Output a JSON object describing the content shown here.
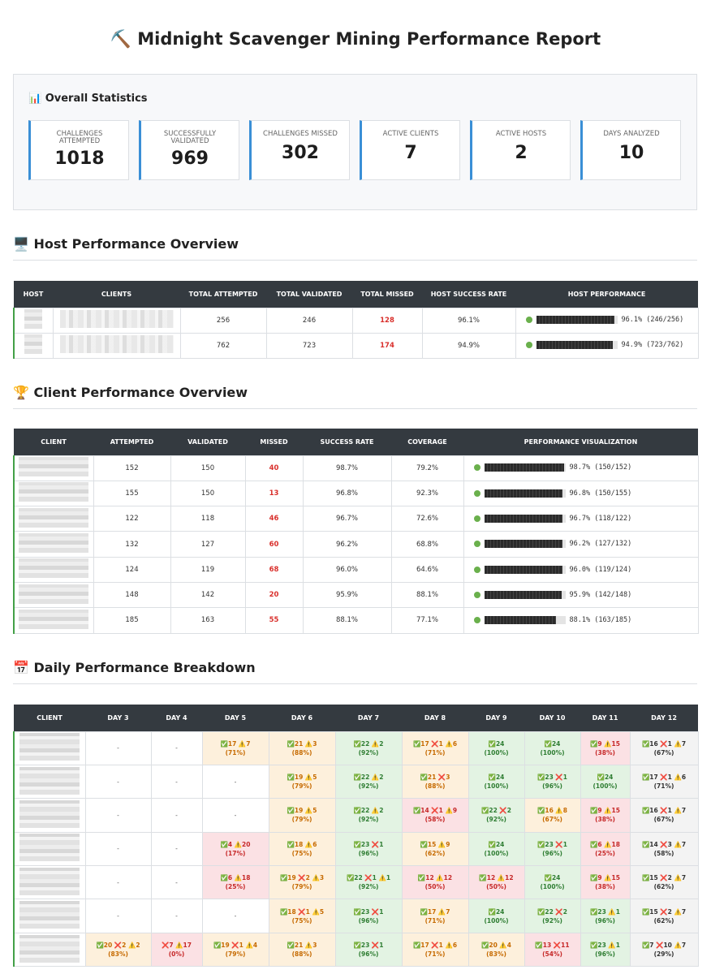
{
  "title": "⛏️ Midnight Scavenger Mining Performance Report",
  "stats": {
    "heading": "📊 Overall Statistics",
    "cards": [
      {
        "label": "Challenges Attempted",
        "value": "1018"
      },
      {
        "label": "Successfully Validated",
        "value": "969"
      },
      {
        "label": "Challenges Missed",
        "value": "302"
      },
      {
        "label": "Active Clients",
        "value": "7"
      },
      {
        "label": "Active Hosts",
        "value": "2"
      },
      {
        "label": "Days Analyzed",
        "value": "10"
      }
    ]
  },
  "host_section": {
    "title": "🖥️ Host Performance Overview",
    "columns": [
      "Host",
      "Clients",
      "Total Attempted",
      "Total Validated",
      "Total Missed",
      "Host Success Rate",
      "Host Performance"
    ],
    "rows": [
      {
        "attempted": "256",
        "validated": "246",
        "missed": "128",
        "rate": "96.1%",
        "viz": "96.1% (246/256)",
        "fill": 0.961
      },
      {
        "attempted": "762",
        "validated": "723",
        "missed": "174",
        "rate": "94.9%",
        "viz": "94.9% (723/762)",
        "fill": 0.949
      }
    ]
  },
  "client_section": {
    "title": "🏆 Client Performance Overview",
    "columns": [
      "Client",
      "Attempted",
      "Validated",
      "Missed",
      "Success Rate",
      "Coverage",
      "Performance Visualization"
    ],
    "rows": [
      {
        "attempted": "152",
        "validated": "150",
        "missed": "40",
        "rate": "98.7%",
        "coverage": "79.2%",
        "viz": "98.7% (150/152)",
        "fill": 0.987
      },
      {
        "attempted": "155",
        "validated": "150",
        "missed": "13",
        "rate": "96.8%",
        "coverage": "92.3%",
        "viz": "96.8% (150/155)",
        "fill": 0.968
      },
      {
        "attempted": "122",
        "validated": "118",
        "missed": "46",
        "rate": "96.7%",
        "coverage": "72.6%",
        "viz": "96.7% (118/122)",
        "fill": 0.967
      },
      {
        "attempted": "132",
        "validated": "127",
        "missed": "60",
        "rate": "96.2%",
        "coverage": "68.8%",
        "viz": "96.2% (127/132)",
        "fill": 0.962
      },
      {
        "attempted": "124",
        "validated": "119",
        "missed": "68",
        "rate": "96.0%",
        "coverage": "64.6%",
        "viz": "96.0% (119/124)",
        "fill": 0.96
      },
      {
        "attempted": "148",
        "validated": "142",
        "missed": "20",
        "rate": "95.9%",
        "coverage": "88.1%",
        "viz": "95.9% (142/148)",
        "fill": 0.959
      },
      {
        "attempted": "185",
        "validated": "163",
        "missed": "55",
        "rate": "88.1%",
        "coverage": "77.1%",
        "viz": "88.1% (163/185)",
        "fill": 0.881
      }
    ]
  },
  "daily_section": {
    "title": "📅 Daily Performance Breakdown",
    "columns": [
      "Client",
      "Day 3",
      "Day 4",
      "Day 5",
      "Day 6",
      "Day 7",
      "Day 8",
      "Day 9",
      "Day 10",
      "Day 11",
      "Day 12"
    ],
    "rows": [
      [
        {
          "t": "-",
          "p": "",
          "c": "empty"
        },
        {
          "t": "-",
          "p": "",
          "c": "empty"
        },
        {
          "t": "✅17 ⚠️7",
          "p": "(71%)",
          "c": "orange"
        },
        {
          "t": "✅21 ⚠️3",
          "p": "(88%)",
          "c": "orange"
        },
        {
          "t": "✅22 ⚠️2",
          "p": "(92%)",
          "c": "green"
        },
        {
          "t": "✅17 ❌1 ⚠️6",
          "p": "(71%)",
          "c": "orange"
        },
        {
          "t": "✅24",
          "p": "(100%)",
          "c": "green"
        },
        {
          "t": "✅24",
          "p": "(100%)",
          "c": "green"
        },
        {
          "t": "✅9 ⚠️15",
          "p": "(38%)",
          "c": "red"
        },
        {
          "t": "✅16 ❌1 ⚠️7",
          "p": "(67%)",
          "c": "gray"
        }
      ],
      [
        {
          "t": "-",
          "p": "",
          "c": "empty"
        },
        {
          "t": "-",
          "p": "",
          "c": "empty"
        },
        {
          "t": "-",
          "p": "",
          "c": "empty"
        },
        {
          "t": "✅19 ⚠️5",
          "p": "(79%)",
          "c": "orange"
        },
        {
          "t": "✅22 ⚠️2",
          "p": "(92%)",
          "c": "green"
        },
        {
          "t": "✅21 ❌3",
          "p": "(88%)",
          "c": "orange"
        },
        {
          "t": "✅24",
          "p": "(100%)",
          "c": "green"
        },
        {
          "t": "✅23 ❌1",
          "p": "(96%)",
          "c": "green"
        },
        {
          "t": "✅24",
          "p": "(100%)",
          "c": "green"
        },
        {
          "t": "✅17 ❌1 ⚠️6",
          "p": "(71%)",
          "c": "gray"
        }
      ],
      [
        {
          "t": "-",
          "p": "",
          "c": "empty"
        },
        {
          "t": "-",
          "p": "",
          "c": "empty"
        },
        {
          "t": "-",
          "p": "",
          "c": "empty"
        },
        {
          "t": "✅19 ⚠️5",
          "p": "(79%)",
          "c": "orange"
        },
        {
          "t": "✅22 ⚠️2",
          "p": "(92%)",
          "c": "green"
        },
        {
          "t": "✅14 ❌1 ⚠️9",
          "p": "(58%)",
          "c": "red"
        },
        {
          "t": "✅22 ❌2",
          "p": "(92%)",
          "c": "green"
        },
        {
          "t": "✅16 ⚠️8",
          "p": "(67%)",
          "c": "orange"
        },
        {
          "t": "✅9 ⚠️15",
          "p": "(38%)",
          "c": "red"
        },
        {
          "t": "✅16 ❌1 ⚠️7",
          "p": "(67%)",
          "c": "gray"
        }
      ],
      [
        {
          "t": "-",
          "p": "",
          "c": "empty"
        },
        {
          "t": "-",
          "p": "",
          "c": "empty"
        },
        {
          "t": "✅4 ⚠️20",
          "p": "(17%)",
          "c": "red"
        },
        {
          "t": "✅18 ⚠️6",
          "p": "(75%)",
          "c": "orange"
        },
        {
          "t": "✅23 ❌1",
          "p": "(96%)",
          "c": "green"
        },
        {
          "t": "✅15 ⚠️9",
          "p": "(62%)",
          "c": "orange"
        },
        {
          "t": "✅24",
          "p": "(100%)",
          "c": "green"
        },
        {
          "t": "✅23 ❌1",
          "p": "(96%)",
          "c": "green"
        },
        {
          "t": "✅6 ⚠️18",
          "p": "(25%)",
          "c": "red"
        },
        {
          "t": "✅14 ❌3 ⚠️7",
          "p": "(58%)",
          "c": "gray"
        }
      ],
      [
        {
          "t": "-",
          "p": "",
          "c": "empty"
        },
        {
          "t": "-",
          "p": "",
          "c": "empty"
        },
        {
          "t": "✅6 ⚠️18",
          "p": "(25%)",
          "c": "red"
        },
        {
          "t": "✅19 ❌2 ⚠️3",
          "p": "(79%)",
          "c": "orange"
        },
        {
          "t": "✅22 ❌1 ⚠️1",
          "p": "(92%)",
          "c": "green"
        },
        {
          "t": "✅12 ⚠️12",
          "p": "(50%)",
          "c": "red"
        },
        {
          "t": "✅12 ⚠️12",
          "p": "(50%)",
          "c": "red"
        },
        {
          "t": "✅24",
          "p": "(100%)",
          "c": "green"
        },
        {
          "t": "✅9 ⚠️15",
          "p": "(38%)",
          "c": "red"
        },
        {
          "t": "✅15 ❌2 ⚠️7",
          "p": "(62%)",
          "c": "gray"
        }
      ],
      [
        {
          "t": "-",
          "p": "",
          "c": "empty"
        },
        {
          "t": "-",
          "p": "",
          "c": "empty"
        },
        {
          "t": "-",
          "p": "",
          "c": "empty"
        },
        {
          "t": "✅18 ❌1 ⚠️5",
          "p": "(75%)",
          "c": "orange"
        },
        {
          "t": "✅23 ❌1",
          "p": "(96%)",
          "c": "green"
        },
        {
          "t": "✅17 ⚠️7",
          "p": "(71%)",
          "c": "orange"
        },
        {
          "t": "✅24",
          "p": "(100%)",
          "c": "green"
        },
        {
          "t": "✅22 ❌2",
          "p": "(92%)",
          "c": "green"
        },
        {
          "t": "✅23 ⚠️1",
          "p": "(96%)",
          "c": "green"
        },
        {
          "t": "✅15 ❌2 ⚠️7",
          "p": "(62%)",
          "c": "gray"
        }
      ],
      [
        {
          "t": "✅20 ❌2 ⚠️2",
          "p": "(83%)",
          "c": "orange"
        },
        {
          "t": "❌7 ⚠️17",
          "p": "(0%)",
          "c": "red"
        },
        {
          "t": "✅19 ❌1 ⚠️4",
          "p": "(79%)",
          "c": "orange"
        },
        {
          "t": "✅21 ⚠️3",
          "p": "(88%)",
          "c": "orange"
        },
        {
          "t": "✅23 ❌1",
          "p": "(96%)",
          "c": "green"
        },
        {
          "t": "✅17 ❌1 ⚠️6",
          "p": "(71%)",
          "c": "orange"
        },
        {
          "t": "✅20 ⚠️4",
          "p": "(83%)",
          "c": "orange"
        },
        {
          "t": "✅13 ❌11",
          "p": "(54%)",
          "c": "red"
        },
        {
          "t": "✅23 ⚠️1",
          "p": "(96%)",
          "c": "green"
        },
        {
          "t": "✅7 ❌10 ⚠️7",
          "p": "(29%)",
          "c": "gray"
        }
      ]
    ]
  }
}
